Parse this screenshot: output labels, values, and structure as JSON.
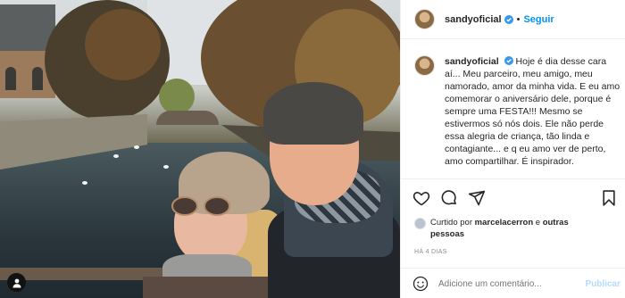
{
  "post": {
    "username": "sandyoficial",
    "follow_label": "Seguir",
    "separator": "•",
    "caption_text": "Hoje é dia desse cara aí... Meu parceiro, meu amigo, meu namorado, amor da minha vida. E eu amo comemorar o aniversário dele, porque é sempre uma FESTA!!! Mesmo se estivermos só nós dois. Ele não perde essa alegria de criança, tão linda e contagiante... e q eu amo ver de perto, amo compartilhar. É inspirador.",
    "liked_prefix": "Curtido por",
    "liked_user": "marcelacerron",
    "liked_connector": "e",
    "liked_others": "outras pessoas",
    "timestamp": "HÁ 4 DIAS",
    "comment_placeholder": "Adicione um comentário...",
    "publish_label": "Publicar"
  },
  "icons": {
    "verified": "verified-badge-icon",
    "like": "heart-icon",
    "comment": "comment-icon",
    "share": "share-icon",
    "save": "bookmark-icon",
    "emoji": "emoji-icon",
    "tag": "user-tag-icon"
  },
  "colors": {
    "accent": "#0095f6",
    "publish_disabled": "#b3dbff",
    "muted": "#8e8e8e",
    "text": "#262626"
  }
}
